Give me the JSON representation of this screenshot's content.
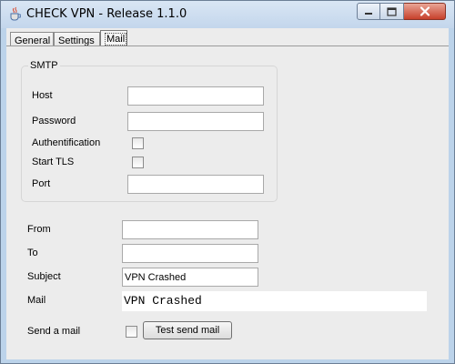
{
  "window": {
    "title": "CHECK VPN - Release 1.1.0",
    "minimize_glyph": "",
    "maximize_glyph": "",
    "close_glyph": ""
  },
  "tabs": [
    {
      "label": "General",
      "active": false
    },
    {
      "label": "Settings",
      "active": false
    },
    {
      "label": "Mail",
      "active": true
    }
  ],
  "smtp": {
    "legend": "SMTP",
    "host_label": "Host",
    "host_value": "",
    "password_label": "Password",
    "password_value": "",
    "auth_label": "Authentification",
    "auth_checked": false,
    "tls_label": "Start TLS",
    "tls_checked": false,
    "port_label": "Port",
    "port_value": ""
  },
  "mail": {
    "from_label": "From",
    "from_value": "",
    "to_label": "To",
    "to_value": "",
    "subject_label": "Subject",
    "subject_value": "VPN Crashed",
    "mail_label": "Mail",
    "mail_value": "VPN Crashed",
    "send_label": "Send a mail",
    "send_checked": false,
    "test_button": "Test send mail"
  },
  "colors": {
    "titlebar": "#c3d6ec",
    "client_bg": "#ececec",
    "close_button": "#c7402b"
  }
}
